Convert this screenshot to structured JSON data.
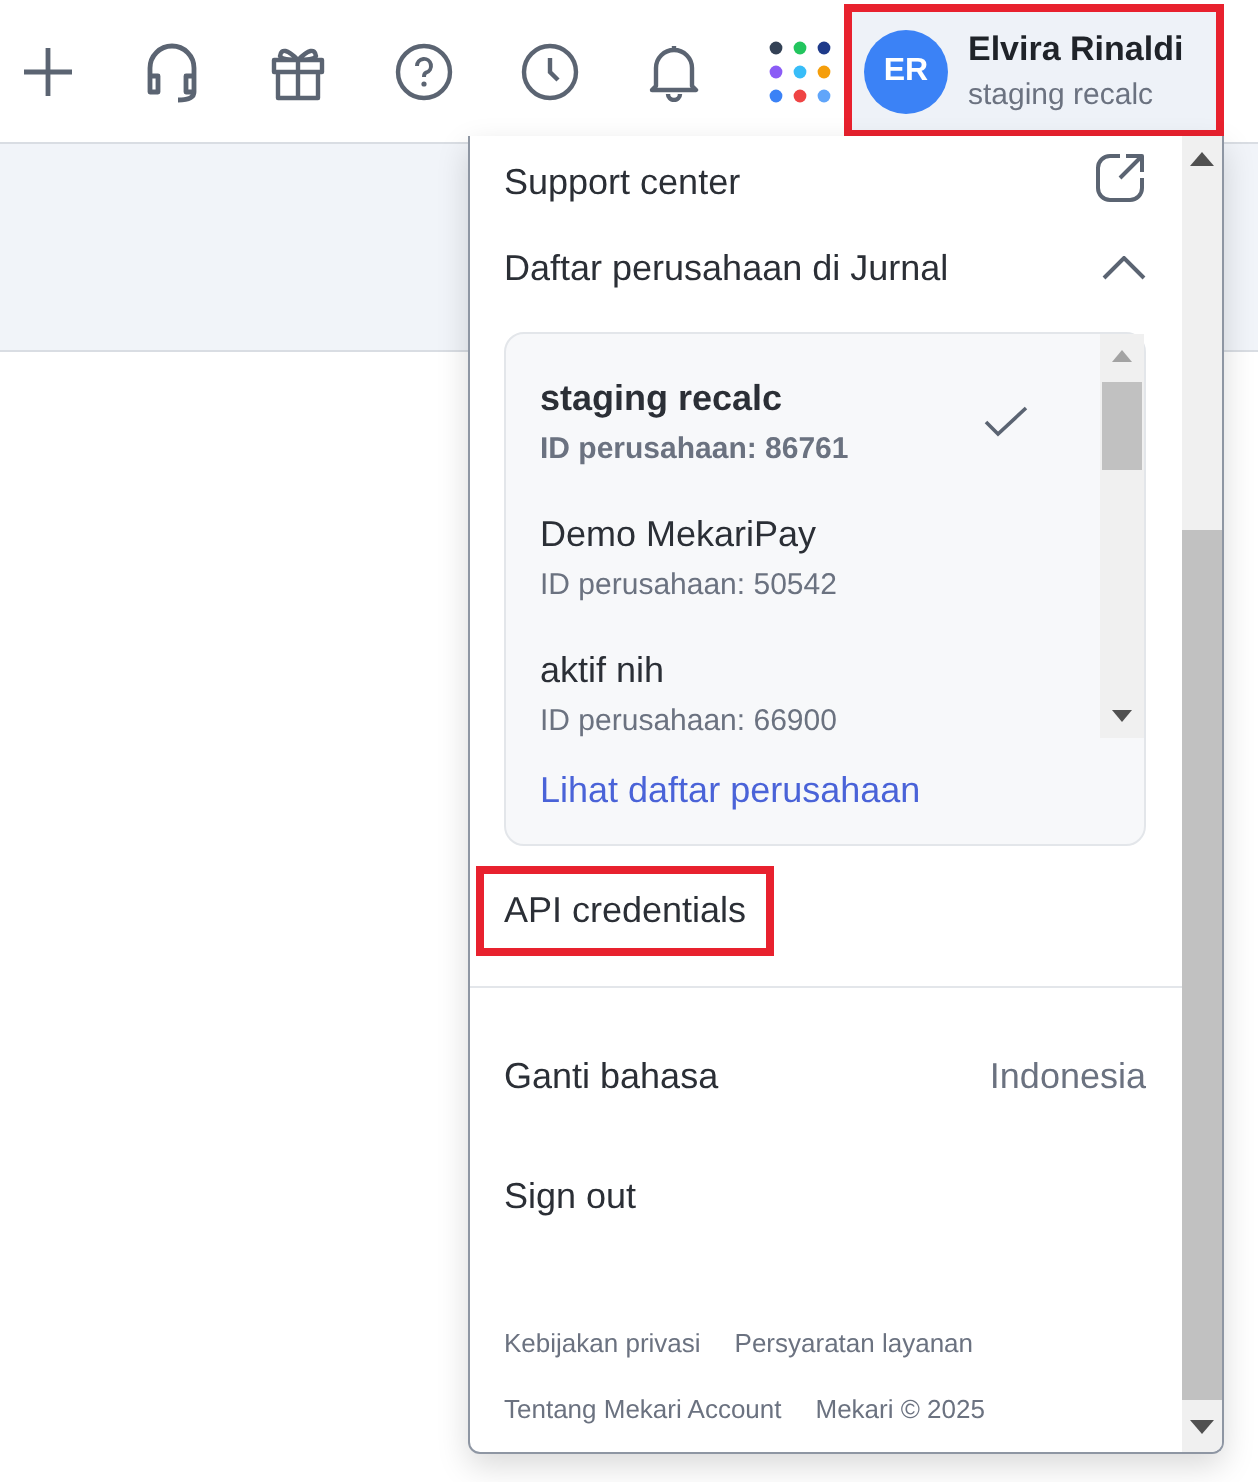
{
  "profile": {
    "initials": "ER",
    "name": "Elvira Rinaldi",
    "company": "staging recalc",
    "highlighted": true
  },
  "menu": [
    {
      "kind": "external",
      "label": "Support center"
    },
    {
      "kind": "section",
      "label": "Daftar perusahaan di Jurnal",
      "expanded": true,
      "companies": [
        {
          "name": "staging recalc",
          "id_label": "ID perusahaan: 86761",
          "selected": true
        },
        {
          "name": "Demo MekariPay",
          "id_label": "ID perusahaan: 50542",
          "selected": false
        },
        {
          "name": "aktif nih",
          "id_label": "ID perusahaan: 66900",
          "selected": false
        }
      ],
      "link": "Lihat daftar perusahaan"
    },
    {
      "kind": "item",
      "label": "API credentials",
      "highlighted": true
    },
    {
      "kind": "divider"
    },
    {
      "kind": "setting",
      "label": "Ganti bahasa",
      "value": "Indonesia"
    },
    {
      "kind": "item",
      "label": "Sign out",
      "highlighted": false
    }
  ],
  "footer": [
    [
      "Kebijakan privasi",
      "Persyaratan layanan"
    ],
    [
      "Tentang Mekari Account",
      "Mekari © 2025"
    ]
  ]
}
